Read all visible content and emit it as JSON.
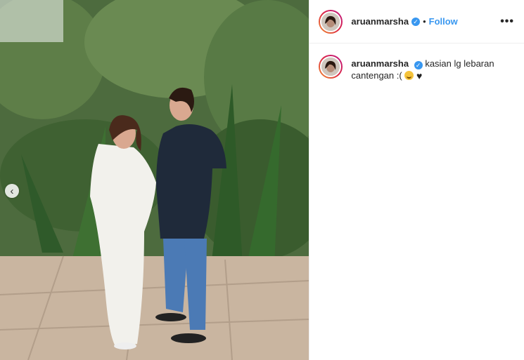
{
  "post": {
    "username": "aruanmarsha",
    "follow_label": "Follow",
    "separator": "•",
    "more_label": "•••",
    "caption_text": "kasian lg lebaran cantengan :(",
    "caption_emojis": [
      "rolling-on-floor-laughing-emoji",
      "black-heart-emoji"
    ],
    "verified": true,
    "carousel_prev": "‹"
  },
  "colors": {
    "accent": "#3897f0",
    "text": "#262626",
    "border": "#efefef"
  }
}
